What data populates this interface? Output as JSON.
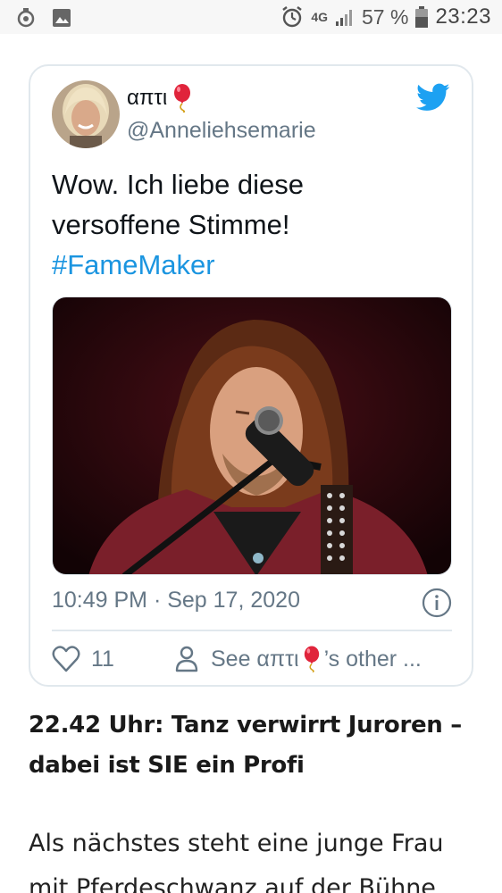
{
  "status_bar": {
    "left_icons": [
      "sync-icon",
      "image-icon"
    ],
    "network": "4G",
    "battery_percent": "57 %",
    "time": "23:23"
  },
  "tweet": {
    "display_name": "απτι",
    "handle": "@Anneliehsemarie",
    "text_line1": "Wow. Ich liebe diese",
    "text_line2": "versoffene Stimme!",
    "hashtag": "#FameMaker",
    "timestamp": "10:49 PM · Sep 17, 2020",
    "like_count": "11",
    "see_other_prefix": "See απτι",
    "see_other_suffix": "’s other ...",
    "colors": {
      "brand": "#1da1f2",
      "hashtag": "#1b95e0",
      "muted": "#657786",
      "border": "#e1e8ed"
    }
  },
  "article": {
    "headline": "22.42 Uhr: Tanz verwirrt Juroren – dabei ist SIE ein Profi",
    "paragraph": "Als nächstes steht eine junge Frau mit Pferdeschwanz auf der Bühne"
  }
}
